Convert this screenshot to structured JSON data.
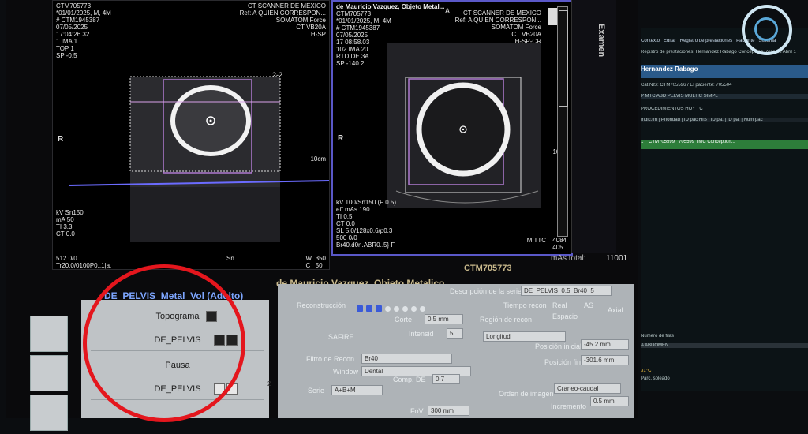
{
  "left_view": {
    "lines": [
      "CTM705773",
      "*01/01/2025, M, 4M",
      "# CTM1945387",
      "07/05/2025",
      "17:04:26.32",
      "1 IMA 1",
      "TOP 1",
      "SP -0.5"
    ],
    "site_lines": [
      "CT SCANNER DE MEXICO",
      "Ref: A QUIEN CORRESPON...",
      "SOMATOM Force",
      "CT VB20A",
      "H-SP"
    ],
    "param_lines": [
      "kV Sn150",
      "mA 50",
      "TI 3.3",
      "CT 0.0"
    ],
    "bottom_lines": [
      "512 0/0",
      "Tr20,0/0100P0..1|a."
    ],
    "R_label": "R",
    "scale": "10cm",
    "W": "W",
    "C": "C",
    "W_val": "350",
    "C_val": "50",
    "Sn": "Sn",
    "mark": "2-2"
  },
  "right_view": {
    "lines": [
      "de Mauricio Vazquez, Objeto Metal...",
      "CTM705773",
      "*01/01/2025, M, 4M",
      "# CTM1945387",
      "07/05/2025",
      "17 08:58.03",
      "102 IMA 20",
      "RTD DE 3A",
      "SP -140.2"
    ],
    "corner_label": "A",
    "site_lines": [
      "CT SCANNER DE MEXICO",
      "Ref: A QUIEN CORRESPON...",
      "SOMATOM Force",
      "CT VB20A",
      "H-SP-CR"
    ],
    "param_lines": [
      "kV 100/Sn150 (F 0.5)",
      "eff mAs 190",
      "TI 0.5",
      "CT 0.0",
      "SL 5.0/128x0.6/p0.3",
      "500 0/0",
      "Br40.d0n.ABR0..5} F."
    ],
    "R_label": "R",
    "scale": "10cm",
    "W_val": "4084",
    "C_val": "405",
    "M_label": "M TTC",
    "examen_label": "Examen"
  },
  "status": {
    "patient_name": "de Mauricio Vazquez, Objeto Metalico",
    "ctm_id": "CTM705773",
    "mas_total_label": "mAs total:",
    "mas_total_value": "11001"
  },
  "protocol": {
    "title": "DE_PELVIS_Metal_Vol (Adulto)",
    "steps": [
      "Topograma",
      "DE_PELVIS",
      "Pausa",
      "DE_PELVIS"
    ],
    "step_index": "2"
  },
  "settings": {
    "reconstruccion_label": "Reconstrucción",
    "recon_numbers": [
      "1",
      "2",
      "3",
      "4",
      "5",
      "6",
      "7",
      "8"
    ],
    "descripcion_label": "Descripción de la serie",
    "descripcion_value": "DE_PELVIS_0.5_Br40_5",
    "tiempo_label": "Tiempo recon",
    "tiempo_opt1": "Real",
    "tiempo_opt2": "AS",
    "corte_label": "Corte",
    "corte_value": "0.5 mm",
    "intensidad_label": "Intensid",
    "intensidad_value": "5",
    "safire_label": "SAFIRE",
    "filtro_label": "Filtro de Recon",
    "filtro_value": "Br40",
    "window_label": "Window",
    "window_value": "Dental",
    "serie_label": "Serie",
    "serie_value": "A+B+M",
    "comp_label": "Comp. DE",
    "comp_value": "0.7",
    "fov_label": "FoV",
    "fov_value": "300 mm",
    "region_label": "Región de recon",
    "region_value": "Longitud",
    "espacio_label": "Espacio",
    "axial_label": "Axial",
    "pos_inicial_label": "Posición inicial",
    "pos_inicial_value": "-45.2 mm",
    "pos_final_label": "Posición final",
    "pos_final_value": "-301.6 mm",
    "orden_label": "Orden de imagen",
    "orden_value": "Craneo-caudal",
    "inc_label": "Incremento",
    "inc_value": "0.5 mm"
  },
  "monitor": {
    "menu": [
      "Contexto",
      "Editar",
      "Registro de prestaciones",
      "Paciente",
      "Sistema"
    ],
    "subtitle": "Registro de prestaciones: Hernandez Rabago Concepcion Rosales Abril 1",
    "patient": "Hernandez Rabago",
    "row1": "Cat.NIS: CTM705596 / El paciente: 705504",
    "row2": "P MTC ABD PELVIS MULTIC SIMPL",
    "headers": "PROCEDIMIENTOS HOY TC",
    "cols": [
      "Indic.tm",
      "Prioridad",
      "ID pac HIS",
      "ID pa.",
      "ID pa.",
      "Num pac"
    ],
    "selected_row": [
      "1",
      "CTM705599",
      "705599",
      "TMC",
      "Conception..."
    ],
    "bottom_field": "Número de filas",
    "bottom_value": "A ABDOMEN",
    "temp": "31°C",
    "temp_sub": "Parc. soleado"
  }
}
